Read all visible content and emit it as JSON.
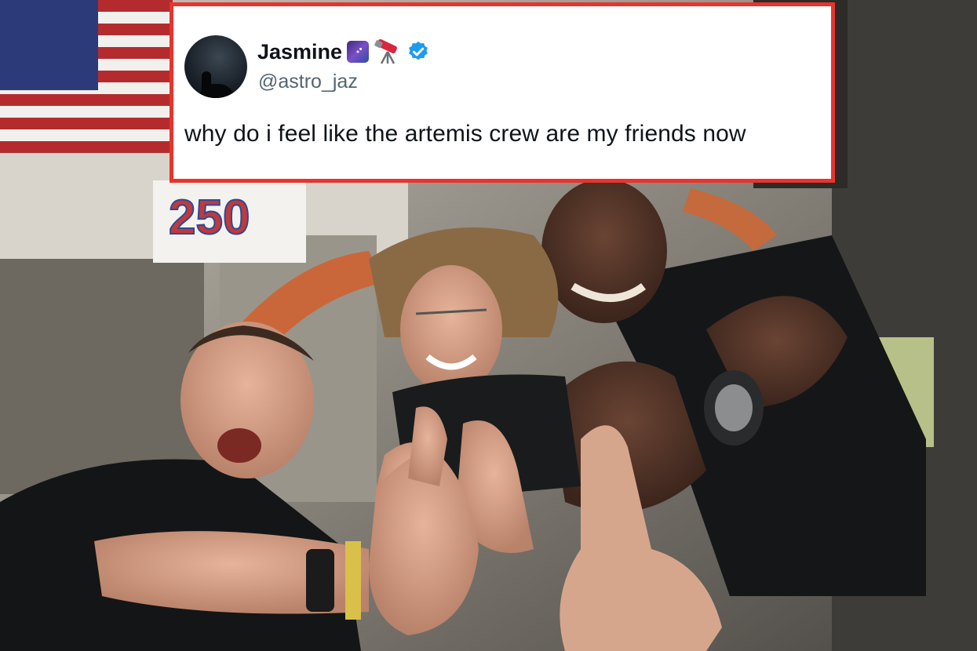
{
  "tweet": {
    "display_name": "Jasmine",
    "emojis": [
      "milky-way-icon",
      "telescope-icon"
    ],
    "verified": true,
    "handle": "@astro_jaz",
    "text": "why do i feel like the artemis crew are my friends now"
  },
  "photo": {
    "banner_text": "250"
  },
  "colors": {
    "card_border": "#e8342c",
    "verified_blue": "#1d9bf0",
    "handle_gray": "#536471",
    "text_dark": "#0f1419"
  }
}
